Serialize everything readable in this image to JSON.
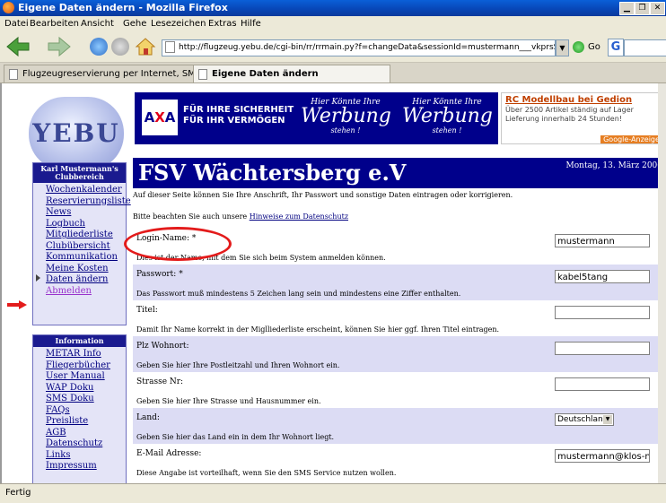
{
  "window": {
    "title": "Eigene Daten ändern - Mozilla Firefox"
  },
  "menu": [
    "Datei",
    "Bearbeiten",
    "Ansicht",
    "Gehe",
    "Lesezeichen",
    "Extras",
    "Hilfe"
  ],
  "toolbar": {
    "url": "http://flugzeug.yebu.de/cgi-bin/rr/rrmain.py?f=changeData&sessionId=mustermann___vkprsS6ecNF38m",
    "go_label": "Go",
    "search_letter": "G"
  },
  "tabs": [
    "Flugzeugreservierung per Internet, SMS u...",
    "Eigene Daten ändern"
  ],
  "logo": "YEBU",
  "banner": {
    "axa_logo": "AXA",
    "axa_line1": "FÜR IHRE SICHERHEIT",
    "axa_line2": "FÜR IHR VERMÖGEN",
    "ad1": {
      "top": "Hier Könnte Ihre",
      "big": "Werbung",
      "bottom": "stehen !"
    },
    "ad2": {
      "top": "Hier Könnte Ihre",
      "big": "Werbung",
      "bottom": "stehen !"
    }
  },
  "google_ad": {
    "title": "RC Modellbau bei Gedion",
    "line1": "Über 2500 Artikel ständig auf Lager",
    "line2": "Lieferung innerhalb 24 Stunden!",
    "footer": "Google-Anzeigen"
  },
  "sidebar": {
    "club_header_1": "Karl Mustermann's",
    "club_header_2": "Clubbereich",
    "club_links": [
      "Wochenkalender",
      "Reservierungsliste",
      "News",
      "Logbuch",
      "Mitgliederliste",
      "Clubübersicht",
      "Kommunikation",
      "Meine Kosten",
      "Daten ändern",
      "Abmelden"
    ],
    "info_header": "Information",
    "info_links": [
      "METAR Info",
      "Fliegerbücher",
      "User Manual",
      "WAP Doku",
      "SMS Doku",
      "FAQs",
      "Preisliste",
      "AGB",
      "Datenschutz",
      "Links",
      "Impressum"
    ]
  },
  "main": {
    "club_name": "FSV Wächtersberg e.V",
    "date": "Montag, 13. März 2006",
    "intro": "Auf dieser Seite können Sie Ihre Anschrift, Ihr Passwort und sonstige Daten eintragen oder korrigieren.",
    "privacy_prefix": "Bitte beachten Sie auch unsere ",
    "privacy_link": "Hinweise zum Datenschutz",
    "fields": {
      "login": {
        "label": "Login-Name: *",
        "value": "mustermann",
        "hint": "Dies ist der Name, mit dem Sie sich beim System anmelden können."
      },
      "password": {
        "label": "Passwort: *",
        "value": "kabel5tang",
        "hint": "Das Passwort muß mindestens 5 Zeichen lang sein und mindestens eine Ziffer enthalten."
      },
      "title": {
        "label": "Titel:",
        "value": "",
        "hint": "Damit Ihr Name korrekt in der Miglliederliste erscheint, können Sie hier ggf. Ihren Titel eintragen."
      },
      "zip": {
        "label": "Plz Wohnort:",
        "value": "",
        "hint": "Geben Sie hier Ihre Postleitzahl und Ihren Wohnort ein."
      },
      "street": {
        "label": "Strasse Nr:",
        "value": "",
        "hint": "Geben Sie hier Ihre Strasse und Hausnummer ein."
      },
      "country": {
        "label": "Land:",
        "value": "Deutschland",
        "hint": "Geben Sie hier das Land ein in dem Ihr Wohnort liegt."
      },
      "email": {
        "label": "E-Mail Adresse:",
        "value": "mustermann@klos-net.",
        "hint": "Diese Angabe ist vorteilhaft, wenn Sie den SMS Service nutzen wollen."
      }
    }
  },
  "status": {
    "text": "Fertig"
  }
}
